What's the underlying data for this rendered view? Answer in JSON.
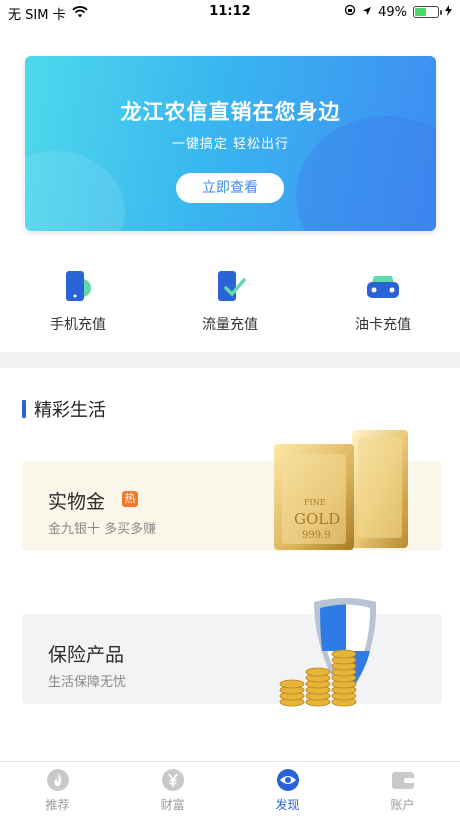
{
  "status_bar": {
    "carrier": "无 SIM 卡",
    "time": "11:12",
    "battery_percent": "49%",
    "battery_level": 0.49
  },
  "banner": {
    "title": "龙江农信直销在您身边",
    "subtitle": "一键搞定 轻松出行",
    "button_label": "立即查看"
  },
  "quick_entries": [
    {
      "label": "手机充值",
      "icon": "phone-recharge-icon"
    },
    {
      "label": "流量充值",
      "icon": "data-recharge-icon"
    },
    {
      "label": "油卡充值",
      "icon": "fuel-card-icon"
    }
  ],
  "section": {
    "title": "精彩生活"
  },
  "cards": {
    "gold": {
      "title": "实物金",
      "badge": "热",
      "subtitle": "金九银十 多买多赚",
      "bar_text_1": "FINE",
      "bar_text_2": "GOLD",
      "bar_text_3": "999.9"
    },
    "insurance": {
      "title": "保险产品",
      "subtitle": "生活保障无忧"
    }
  },
  "tabbar": {
    "items": [
      {
        "label": "推荐",
        "icon": "flame-icon",
        "active": false
      },
      {
        "label": "财富",
        "icon": "yen-coin-icon",
        "active": false
      },
      {
        "label": "发现",
        "icon": "eye-icon",
        "active": true
      },
      {
        "label": "账户",
        "icon": "wallet-icon",
        "active": false
      }
    ]
  },
  "colors": {
    "accent": "#2a63d6",
    "banner_start": "#4fd9ec",
    "banner_end": "#3f8bf2",
    "hot_badge": "#f07a2a"
  }
}
